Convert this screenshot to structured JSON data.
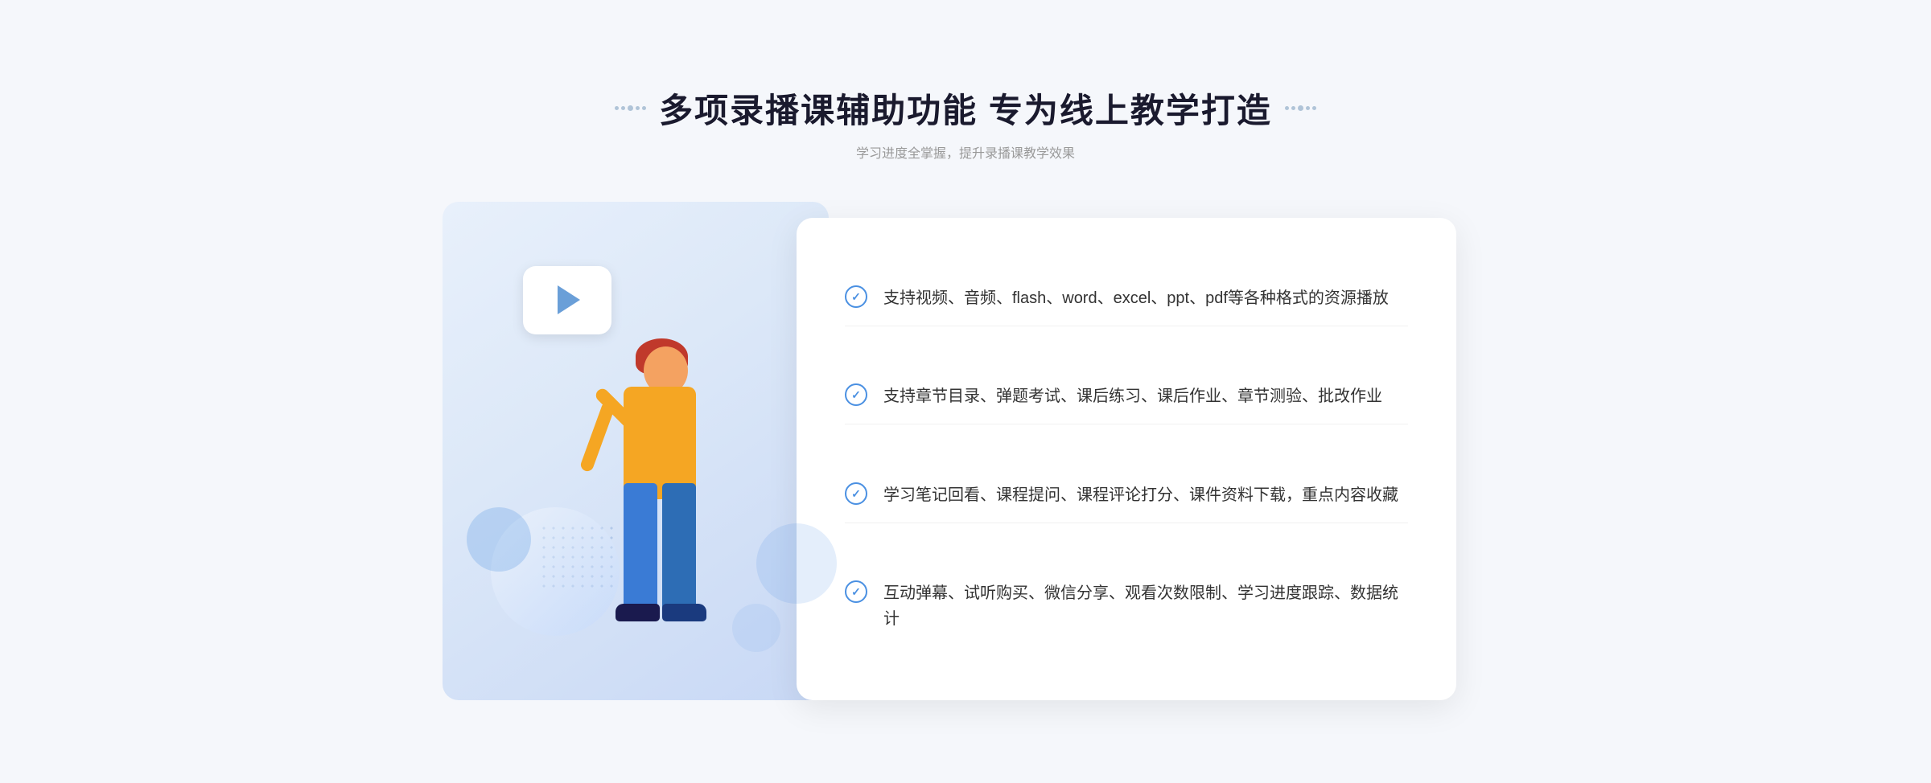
{
  "header": {
    "title": "多项录播课辅助功能 专为线上教学打造",
    "subtitle": "学习进度全掌握，提升录播课教学效果"
  },
  "features": [
    {
      "id": 1,
      "text": "支持视频、音频、flash、word、excel、ppt、pdf等各种格式的资源播放"
    },
    {
      "id": 2,
      "text": "支持章节目录、弹题考试、课后练习、课后作业、章节测验、批改作业"
    },
    {
      "id": 3,
      "text": "学习笔记回看、课程提问、课程评论打分、课件资料下载，重点内容收藏"
    },
    {
      "id": 4,
      "text": "互动弹幕、试听购买、微信分享、观看次数限制、学习进度跟踪、数据统计"
    }
  ],
  "decorations": {
    "side_arrow": "»"
  }
}
